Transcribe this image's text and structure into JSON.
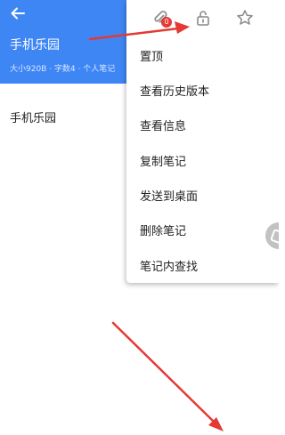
{
  "header": {
    "title": "手机乐园",
    "meta": "大小920B · 字数4 · 个人笔记"
  },
  "body": {
    "text": "手机乐园"
  },
  "popup": {
    "icons": [
      "attachment-icon",
      "unlock-icon",
      "star-icon"
    ],
    "attachment_badge": "0",
    "items": [
      "置顶",
      "查看历史版本",
      "查看信息",
      "复制笔记",
      "发送到桌面",
      "删除笔记",
      "笔记内查找"
    ]
  },
  "colors": {
    "header_bg": "#3f86f5",
    "annotation_arrow": "#e53935",
    "badge": "#e53935"
  }
}
